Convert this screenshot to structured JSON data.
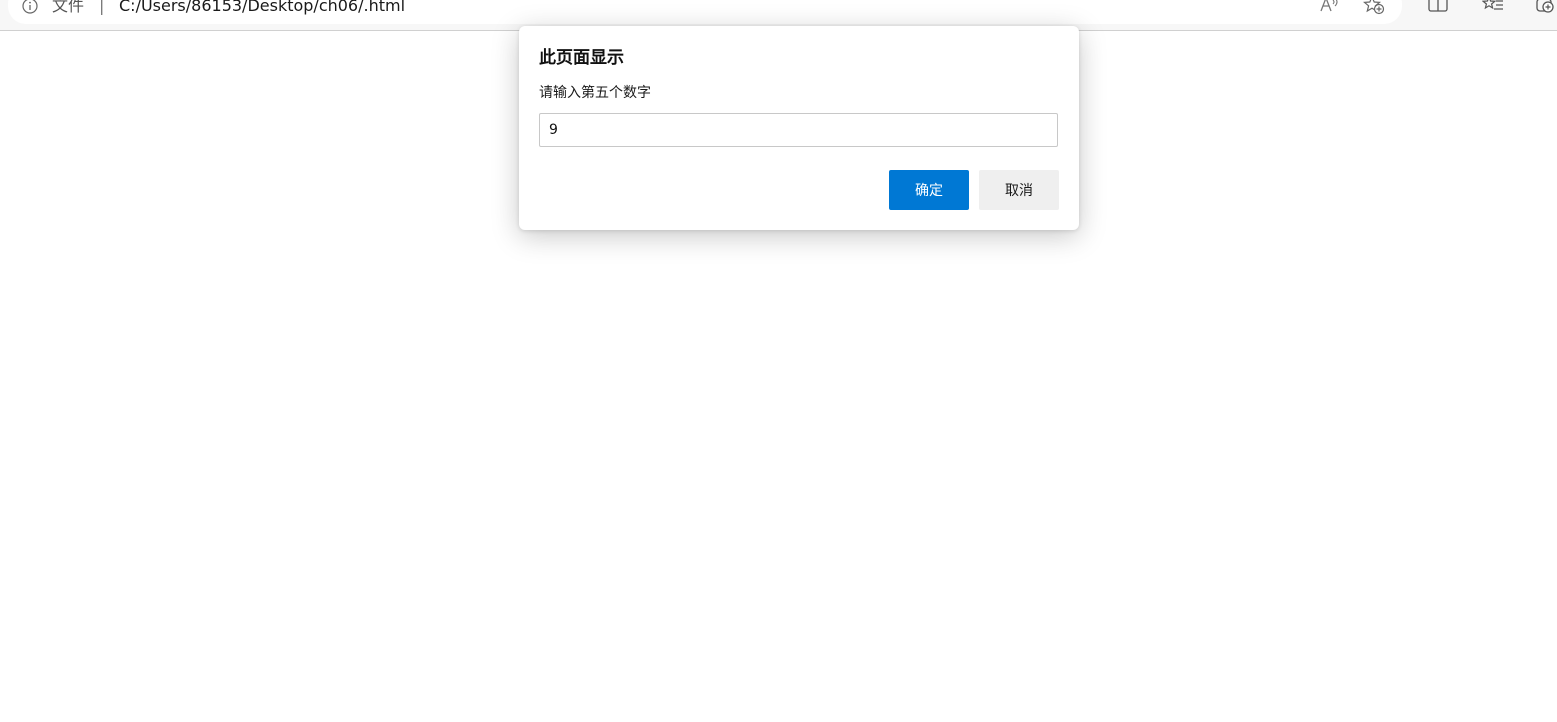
{
  "browser": {
    "scheme_label": "文件",
    "separator": "|",
    "url": "C:/Users/86153/Desktop/ch06/.html",
    "icons": [
      "info-icon",
      "read-aloud-icon",
      "add-favorite-icon",
      "split-screen-icon",
      "favorites-icon",
      "collections-icon"
    ]
  },
  "dialog": {
    "title": "此页面显示",
    "message": "请输入第五个数字",
    "input_value": "9",
    "ok_label": "确定",
    "cancel_label": "取消"
  },
  "colors": {
    "accent": "#0078d4",
    "cancel_bg": "#efefef"
  }
}
